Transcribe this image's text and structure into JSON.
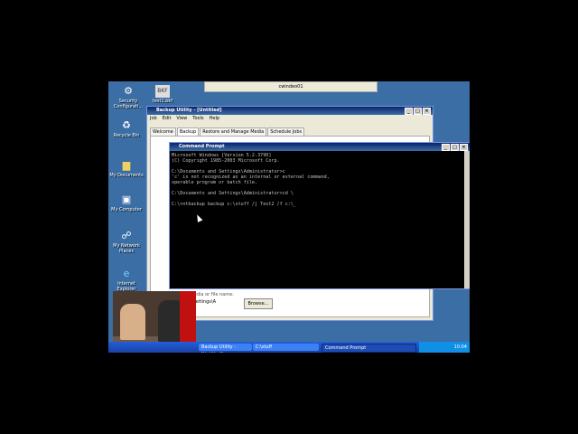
{
  "desktop": {
    "icons": [
      {
        "label": "Security Configurati...",
        "icon": "shield-icon"
      },
      {
        "label": "test1.bkf",
        "icon": "bkf-file-icon"
      },
      {
        "label": "Recycle Bin",
        "icon": "recycle-bin-icon"
      },
      {
        "label": "My Documents",
        "icon": "folder-icon"
      },
      {
        "label": "My Computer",
        "icon": "computer-icon"
      },
      {
        "label": "My Network Places",
        "icon": "network-icon"
      },
      {
        "label": "Internet Explorer",
        "icon": "ie-icon"
      }
    ]
  },
  "background_window": {
    "title": "cwindeo01"
  },
  "backup_window": {
    "title": "Backup Utility - [Untitled]",
    "menu": [
      "Job",
      "Edit",
      "View",
      "Tools",
      "Help"
    ],
    "tabs": [
      "Welcome",
      "Backup",
      "Restore and Manage Media",
      "Schedule Jobs"
    ],
    "path_hint": "Backup media or file name:",
    "path_value": "ents and Settings\\A",
    "browse_label": "Browse..."
  },
  "cmd_window": {
    "title": "Command Prompt",
    "lines": "Microsoft Windows [Version 5.2.3790]\n(C) Copyright 1985-2003 Microsoft Corp.\n\nC:\\Documents and Settings\\Administrator>c\n'c' is not recognized as an internal or external command,\noperable program or batch file.\n\nC:\\Documents and Settings\\Administrator>cd \\\n\nC:\\>ntbackup backup c:\\stuff /j Test2 /f c:\\_"
  },
  "taskbar": {
    "tasks": [
      "Backup Utility - [Untitled]",
      "C:\\stuff",
      "Command Prompt"
    ],
    "clock": "10:04"
  },
  "colors": {
    "desktop": "#3a6ea5",
    "titlebar": "#0a246a",
    "taskbar": "#245edb"
  }
}
